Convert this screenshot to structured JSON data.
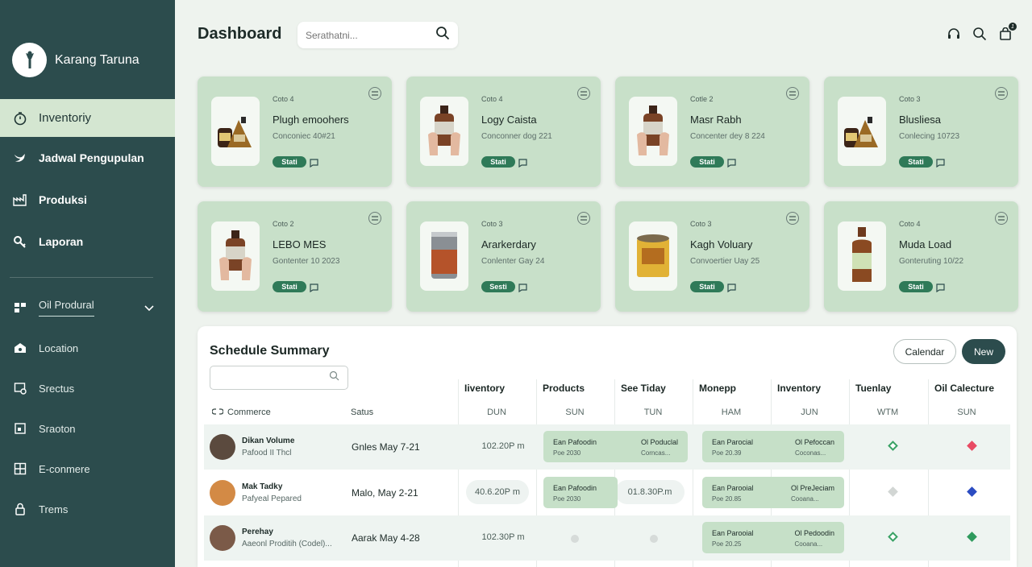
{
  "brand": {
    "name": "Karang Taruna"
  },
  "nav": {
    "items": [
      {
        "label": "Inventoriy",
        "icon": "timer-icon"
      },
      {
        "label": "Jadwal Pengupulan",
        "icon": "bird-icon"
      },
      {
        "label": "Produksi",
        "icon": "factory-icon"
      },
      {
        "label": "Laporan",
        "icon": "key-icon"
      }
    ],
    "sub_items": [
      {
        "label": "Oil Produral",
        "icon": "blocks-icon"
      },
      {
        "label": "Location",
        "icon": "home-icon"
      },
      {
        "label": "Srectus",
        "icon": "image-icon"
      },
      {
        "label": "Sraoton",
        "icon": "frame-icon"
      },
      {
        "label": "E-conmere",
        "icon": "grid-icon"
      },
      {
        "label": "Trems",
        "icon": "lock-icon"
      }
    ]
  },
  "header": {
    "title": "Dashboard",
    "search_placeholder": "Serathatni..."
  },
  "colors": {
    "sidebar": "#2c4c4d",
    "card": "#c8e0c9",
    "accent": "#2f7a58",
    "new_button": "#2c4c4d"
  },
  "cards": [
    {
      "cat": "Coto 4",
      "name": "Plugh emoohers",
      "meta": "Conconiec 40#21",
      "pill": "Stati",
      "img": "two-jars"
    },
    {
      "cat": "Coto 4",
      "name": "Logy Caista",
      "meta": "Conconner dog 221",
      "pill": "Stati",
      "img": "hand-bottle"
    },
    {
      "cat": "Cotle 2",
      "name": "Masr Rabh",
      "meta": "Concenter dey 8 224",
      "pill": "Stati",
      "img": "hand-bottle"
    },
    {
      "cat": "Coto 3",
      "name": "Blusliesa",
      "meta": "Conlecing 10723",
      "pill": "Stati",
      "img": "two-jars"
    },
    {
      "cat": "Coto 2",
      "name": "LEBO MES",
      "meta": "Gontenter 10 2023",
      "pill": "Stati",
      "img": "hand-bottle"
    },
    {
      "cat": "Coto 3",
      "name": "Ararkerdary",
      "meta": "Conlenter Gay 24",
      "pill": "Sesti",
      "img": "tin-can"
    },
    {
      "cat": "Coto 3",
      "name": "Kagh Voluary",
      "meta": "Convoertier Uay 25",
      "pill": "Stati",
      "img": "paint-can"
    },
    {
      "cat": "Coto 4",
      "name": "Muda Load",
      "meta": "Gonteruting 10/22",
      "pill": "Stati",
      "img": "brown-bottle"
    }
  ],
  "schedule": {
    "title": "Schedule Summary",
    "calendar_label": "Calendar",
    "new_label": "New",
    "left_headers": [
      "Commerce",
      "Satus"
    ],
    "columns": [
      {
        "label": "Iiventory",
        "sub": "DUN"
      },
      {
        "label": "Products",
        "sub": "SUN"
      },
      {
        "label": "See Tiday",
        "sub": "TUN"
      },
      {
        "label": "Monepp",
        "sub": "HAM"
      },
      {
        "label": "Inventory",
        "sub": "JUN"
      },
      {
        "label": "Tuenlay",
        "sub": "WTM"
      },
      {
        "label": "Oil Calecture",
        "sub": "SUN"
      }
    ],
    "rows": [
      {
        "name": "Dikan Volume",
        "sub": "Pafood II Thcl",
        "status": "Gnles May 7-21",
        "time": "102.20P m",
        "ev1": {
          "a": "Ean Pafoodin",
          "a2": "Poe 2030",
          "b": "Ol Poduclal",
          "b2": "Corncas..."
        },
        "ev2": {
          "a": "Ean Parocial",
          "a2": "Poe 20.39",
          "b": "Ol Pefoccan",
          "b2": "Coconas..."
        }
      },
      {
        "name": "Mak Tadky",
        "sub": "Pafyeal Pepared",
        "status": "Malo, May 2-21",
        "time": "40.6.20P m",
        "time2": "01.8.30P.m",
        "ev1": {
          "a": "Ean Pafoodin",
          "a2": "Poe 2030",
          "b": "",
          "b2": ""
        },
        "ev2": {
          "a": "Ean Parooial",
          "a2": "Poe 20.85",
          "b": "Ol PreJeciam",
          "b2": "Cooana..."
        }
      },
      {
        "name": "Perehay",
        "sub": "Aaeonl Proditih (Codel)...",
        "status": "Aarak May 4-28",
        "time": "102.30P m",
        "ev2": {
          "a": "Ean Parooial",
          "a2": "Poe 20.25",
          "b": "Ol Pedoodin",
          "b2": "Cooana..."
        }
      }
    ]
  }
}
